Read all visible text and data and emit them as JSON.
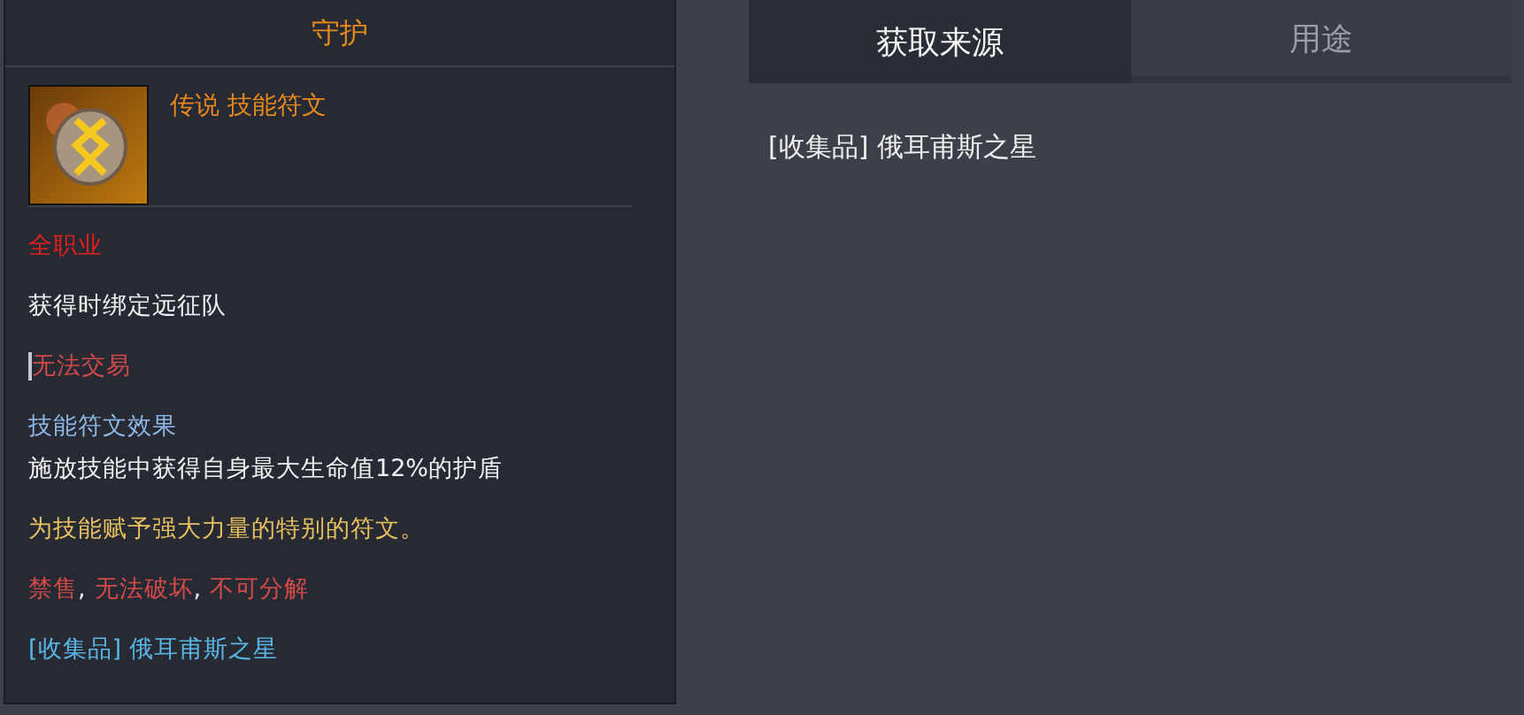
{
  "tooltip": {
    "title": "守护",
    "item": {
      "grade": "传说",
      "type": "技能符文"
    },
    "lines": [
      {
        "kind": "class",
        "text": "全职业"
      },
      {
        "kind": "bind",
        "text": "获得时绑定远征队"
      },
      {
        "kind": "trade",
        "text": "无法交易"
      },
      {
        "kind": "effect_title",
        "text": "技能符文效果"
      },
      {
        "kind": "effect",
        "text": "施放技能中获得自身最大生命值12%的护盾"
      },
      {
        "kind": "description",
        "text": "为技能赋予强大力量的特别的符文。"
      },
      {
        "kind": "restrictions",
        "segments": [
          {
            "kind": "restriction",
            "text": "禁售"
          },
          {
            "kind": "separator",
            "text": ","
          },
          {
            "kind": "restriction",
            "text": "无法破坏"
          },
          {
            "kind": "separator",
            "text": ","
          },
          {
            "kind": "restriction",
            "text": "不可分解"
          }
        ]
      },
      {
        "kind": "source",
        "text": "[收集品] 俄耳甫斯之星"
      }
    ]
  },
  "tabs": [
    {
      "label": "获取来源",
      "selected": true
    },
    {
      "label": "用途",
      "selected": false
    }
  ],
  "sources": [
    "[收集品] 俄耳甫斯之星"
  ]
}
